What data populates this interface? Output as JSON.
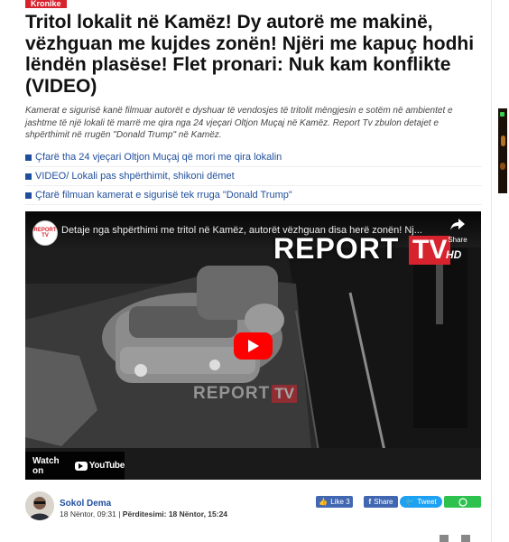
{
  "article": {
    "category": "Kronike",
    "headline": "Tritol lokalit në Kamëz! Dy autorë me makinë, vëzhguan me kujdes zonën! Njëri me kapuç hodhi lëndën plasëse! Flet pronari: Nuk kam konflikte (VIDEO)",
    "lead": "Kamerat e sigurisë kanë filmuar autorët e dyshuar të vendosjes të tritolit mëngjesin e sotëm në ambientet e jashtme të një lokali të marrë me qira nga 24 vjeçari Oltjon Muçaj në Kamëz. Report Tv zbulon detajet e shpërthimit në rrugën \"Donald Trump\" në Kamëz.",
    "related": [
      "Çfarë tha 24 vjeçari Oltjon Muçaj që mori me qira lokalin",
      "VIDEO/ Lokali pas shpërthimit, shikoni dëmet",
      "Çfarë filmuan kamerat e sigurisë tek rruga \"Donald Trump\""
    ]
  },
  "video": {
    "channel_badge": "REPORT TV",
    "title": "Detaje nga shpërthimi me tritol në Kamëz, autorët vëzhguan disa herë zonën! Nj...",
    "share_label": "Share",
    "watermark_report": "REPORT",
    "watermark_tv": "TV",
    "watermark_hd": "HD",
    "watch_on_label": "Watch on",
    "youtube_label": "YouTube"
  },
  "author": {
    "name": "Sokol Dema",
    "date": "18 Nëntor, 09:31",
    "updated_label": "Përditesimi:",
    "updated": "18 Nëntor, 15:24"
  },
  "share_buttons": {
    "like_label": "Like",
    "like_count": "3",
    "share_label": "Share",
    "tweet_label": "Tweet"
  },
  "colors": {
    "brand_red": "#d7232e",
    "link_blue": "#1f4e9c",
    "facebook": "#4267b2",
    "twitter": "#1da1f2",
    "whatsapp": "#2dc24d"
  }
}
